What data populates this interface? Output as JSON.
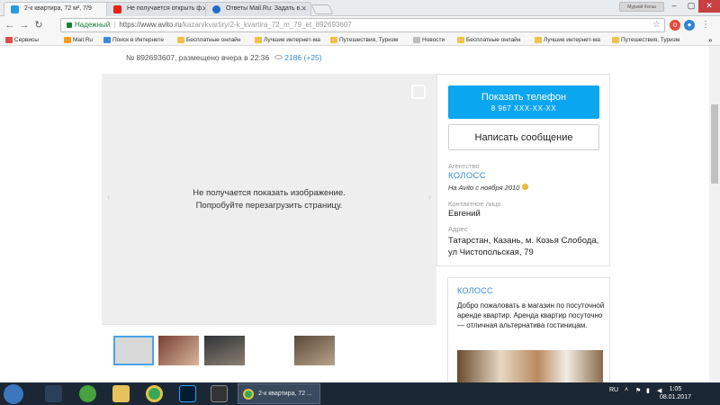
{
  "browser": {
    "tabs": [
      {
        "label": "2-к квартира, 72 м², 7/9",
        "color": "#2a9be0"
      },
      {
        "label": "Не получается открыть ф...",
        "color": "#e62117"
      },
      {
        "label": "Ответы Mail.Ru: Задать в...",
        "color": "#1c6cc9"
      }
    ],
    "profile": "Мурзой Ксюш",
    "address": {
      "secure_label": "Надежный",
      "url_base": "https://www.avito.ru",
      "url_path": "/kazan/kvartiry/2-k_kvartira_72_m_79_et_892693607"
    },
    "bookmarks": [
      {
        "label": "Сервисы",
        "color": "#e04b4b"
      },
      {
        "label": "",
        "color": "#e62117"
      },
      {
        "label": "Mail.Ru",
        "color": "#f79d18"
      },
      {
        "label": "Поиск в Интернете",
        "color": "#3c8adb"
      },
      {
        "label": "Бесплатные онлайн",
        "color": "#f0c24b"
      },
      {
        "label": "Лучшие интернет-ма",
        "color": "#f0c24b"
      },
      {
        "label": "Путешествия, Туризм",
        "color": "#f0c24b"
      },
      {
        "label": "Новости",
        "color": "#bdbdbd"
      },
      {
        "label": "Бесплатные онлайн",
        "color": "#f0c24b"
      },
      {
        "label": "Лучшие интернет-ма",
        "color": "#f0c24b"
      },
      {
        "label": "Путешествия, Туризм",
        "color": "#f0c24b"
      }
    ]
  },
  "listing": {
    "meta": "№ 892693607, размещено вчера в 22:36",
    "views": "2186 (+25)",
    "gallery_message_line1": "Не получается показать изображение.",
    "gallery_message_line2": "Попробуйте перезагрузить страницу.",
    "thumbnails": [
      {
        "color": "#d9d9d9"
      },
      {
        "color": "#8b4a3c"
      },
      {
        "color": "#4b4f55"
      },
      {
        "color": "#ffffff"
      },
      {
        "color": "#6e5a44"
      }
    ]
  },
  "seller": {
    "show_phone": "Показать телефон",
    "phone_masked": "8 967 XXX-XX-XX",
    "write_message": "Написать сообщение",
    "agency_label": "Агентство",
    "agency_name": "КОЛОСС",
    "since": "На Avito с ноября 2010",
    "contact_label": "Контактное лицо",
    "contact_name": "Евгений",
    "address_label": "Адрес",
    "address": "Татарстан, Казань, м. Козья Слобода, ул Чистопольская, 79"
  },
  "ad": {
    "title": "КОЛОСС",
    "text": "Добро пожаловать в магазин по посуточной аренде квартир. Аренда квартир посуточно — отличная альтернатива гостиницам."
  },
  "taskbar": {
    "chrome_window": "2-к квартира, 72 ...",
    "lang": "RU",
    "time": "1:05",
    "date": "08.01.2017"
  }
}
